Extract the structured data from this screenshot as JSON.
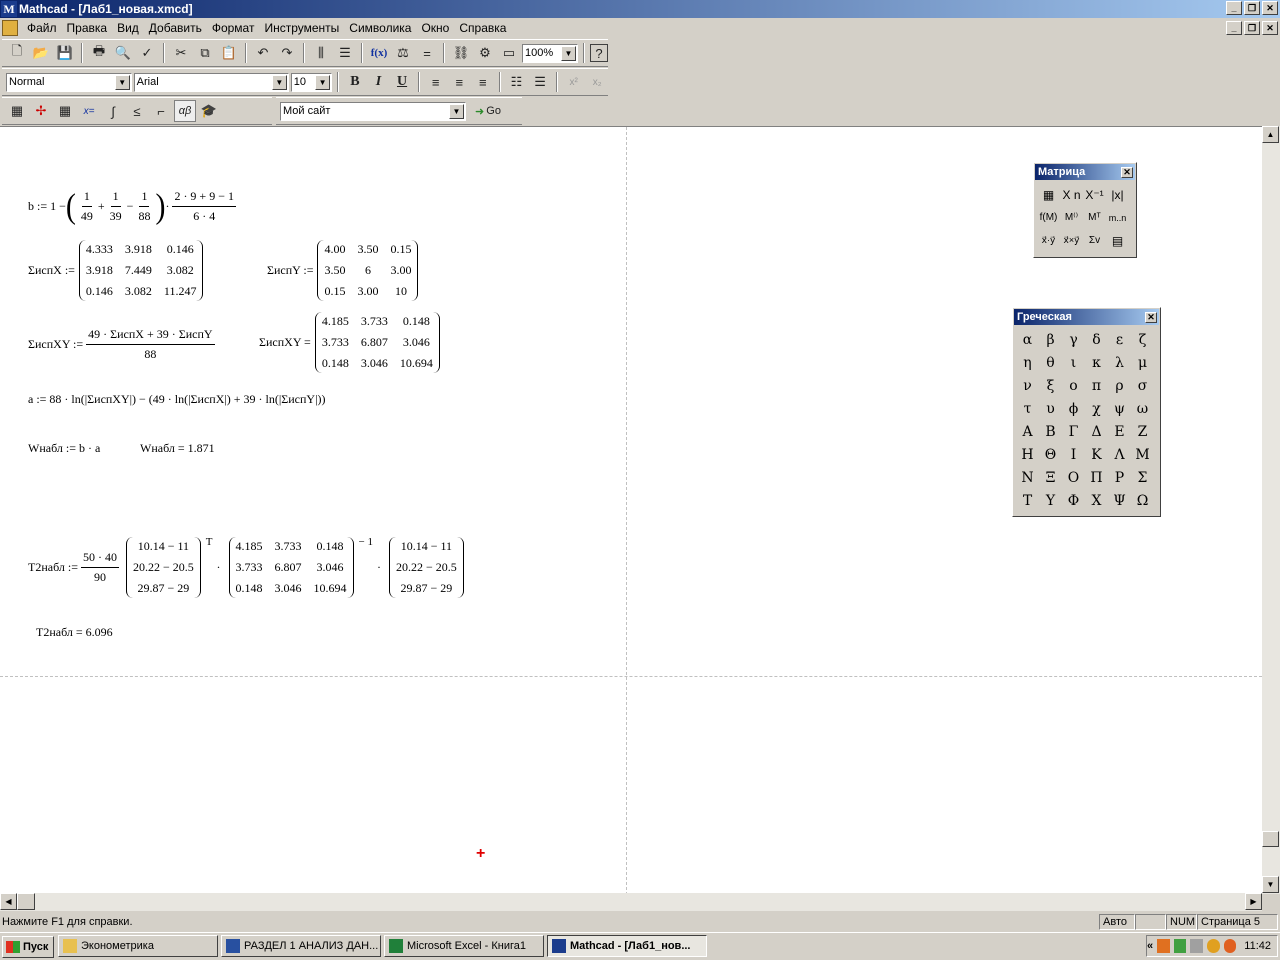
{
  "window": {
    "title": "Mathcad - [Лаб1_новая.xmcd]",
    "app_letter": "M"
  },
  "menu": [
    "Файл",
    "Правка",
    "Вид",
    "Добавить",
    "Формат",
    "Инструменты",
    "Символика",
    "Окно",
    "Справка"
  ],
  "toolbar_std": {
    "zoom": "100%",
    "fx": "f(x)",
    "help": "?"
  },
  "toolbar_fmt": {
    "style": "Normal",
    "font": "Arial",
    "size": "10",
    "bold": "B",
    "italic": "I",
    "underline": "U",
    "sup": "x²",
    "sub": "x₂"
  },
  "toolbar_math": {
    "eq": "x=",
    "ab": "αβ",
    "site": "Мой сайт",
    "go": "Go"
  },
  "doc": {
    "b_lhs": "b := 1 −",
    "b_f1n": "1",
    "b_f1d": "49",
    "b_plus1": "+",
    "b_f2n": "1",
    "b_f2d": "39",
    "b_minus": "−",
    "b_f3n": "1",
    "b_f3d": "88",
    "b_dot": "·",
    "b_f4n": "2 · 9 + 9 − 1",
    "b_f4d": "6 · 4",
    "sx_lhs": "ΣиспX :=",
    "sx": [
      "4.333",
      "3.918",
      "0.146",
      "3.918",
      "7.449",
      "3.082",
      "0.146",
      "3.082",
      "11.247"
    ],
    "sy_lhs": "ΣиспY :=",
    "sy": [
      "4.00",
      "3.50",
      "0.15",
      "3.50",
      "6",
      "3.00",
      "0.15",
      "3.00",
      "10"
    ],
    "sxy_lhs": "ΣиспXY :=",
    "sxy_num": "49 · ΣиспX + 39 · ΣиспY",
    "sxy_den": "88",
    "sxy2_lhs": "ΣиспXY =",
    "sxy": [
      "4.185",
      "3.733",
      "0.148",
      "3.733",
      "6.807",
      "3.046",
      "0.148",
      "3.046",
      "10.694"
    ],
    "a_expr": "a := 88 · ln(|ΣиспXY|) − (49 · ln(|ΣиспX|) + 39 · ln(|ΣиспY|))",
    "w_def": "Wнабл := b · a",
    "w_val": "Wнабл = 1.871",
    "t2_lhs": "T2набл :=",
    "t2_num": "50 · 40",
    "t2_den": "90",
    "t2_v": [
      "10.14 − 11",
      "20.22 − 20.5",
      "29.87 − 29"
    ],
    "t2_sup1": "T",
    "t2_sup2": "− 1",
    "t2_dot": "·",
    "t2_val": "T2набл = 6.096"
  },
  "matrix_panel": {
    "title": "Матрица",
    "close": "✕",
    "items": [
      "▦",
      "X n",
      "X⁻¹",
      "|x|",
      "f(M)",
      "M⁽⁾",
      "Mᵀ",
      "m..n",
      "x⃗·y⃗",
      "x⃗×y⃗",
      "Σv",
      "▤"
    ]
  },
  "greek_panel": {
    "title": "Греческая",
    "close": "✕",
    "letters": [
      "α",
      "β",
      "γ",
      "δ",
      "ε",
      "ζ",
      "η",
      "θ",
      "ι",
      "κ",
      "λ",
      "μ",
      "ν",
      "ξ",
      "ο",
      "π",
      "ρ",
      "σ",
      "τ",
      "υ",
      "ϕ",
      "χ",
      "ψ",
      "ω",
      "Α",
      "Β",
      "Γ",
      "Δ",
      "Ε",
      "Ζ",
      "Η",
      "Θ",
      "Ι",
      "Κ",
      "Λ",
      "Μ",
      "Ν",
      "Ξ",
      "Ο",
      "Π",
      "Ρ",
      "Σ",
      "Τ",
      "Υ",
      "Φ",
      "Χ",
      "Ψ",
      "Ω"
    ]
  },
  "status": {
    "help": "Нажмите F1 для справки.",
    "auto": "Авто",
    "num": "NUM",
    "page": "Страница 5"
  },
  "taskbar": {
    "start": "Пуск",
    "tasks": [
      "Эконометрика",
      "РАЗДЕЛ 1 АНАЛИЗ ДАН...",
      "Microsoft Excel - Книга1",
      "Mathcad - [Лаб1_нов..."
    ],
    "tray_arrow": "«",
    "time": "11:42"
  }
}
